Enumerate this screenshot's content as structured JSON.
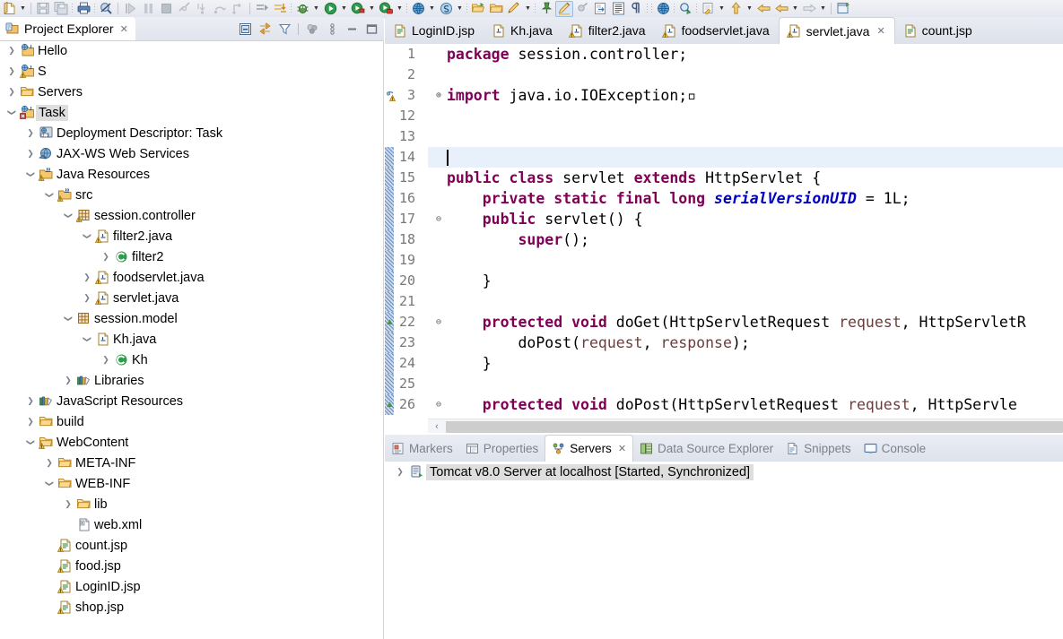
{
  "window": {
    "app": "Eclipse IDE"
  },
  "toolbar": {
    "items": [
      {
        "name": "new-wizard-icon",
        "kind": "icon",
        "icon": "new-file"
      },
      {
        "name": "new-wizard-dropdown",
        "kind": "arrow"
      },
      {
        "name": "toolbar-separator-1",
        "kind": "sep"
      },
      {
        "name": "save-icon",
        "kind": "icon",
        "icon": "save"
      },
      {
        "name": "save-all-icon",
        "kind": "icon",
        "icon": "save-all"
      },
      {
        "name": "toolbar-separator-2",
        "kind": "dots"
      },
      {
        "name": "print-icon",
        "kind": "icon",
        "icon": "print"
      },
      {
        "name": "toolbar-separator-3",
        "kind": "dots"
      },
      {
        "name": "no-search-icon",
        "kind": "icon",
        "icon": "search-disabled"
      },
      {
        "name": "toolbar-separator-4",
        "kind": "sep"
      },
      {
        "name": "resume-icon",
        "kind": "icon",
        "icon": "resume"
      },
      {
        "name": "suspend-icon",
        "kind": "icon",
        "icon": "suspend"
      },
      {
        "name": "terminate-icon",
        "kind": "icon",
        "icon": "terminate"
      },
      {
        "name": "disconnect-icon",
        "kind": "icon",
        "icon": "disconnect"
      },
      {
        "name": "step-into-icon",
        "kind": "icon",
        "icon": "step-into"
      },
      {
        "name": "step-over-icon",
        "kind": "icon",
        "icon": "step-over"
      },
      {
        "name": "step-return-icon",
        "kind": "icon",
        "icon": "step-return"
      },
      {
        "name": "toolbar-separator-5",
        "kind": "sep"
      },
      {
        "name": "next-annotation-icon",
        "kind": "icon",
        "icon": "next-annot"
      },
      {
        "name": "previous-annotation-icon",
        "kind": "icon",
        "icon": "prev-annot"
      },
      {
        "name": "toolbar-separator-6",
        "kind": "dots"
      },
      {
        "name": "debug-icon",
        "kind": "icon",
        "icon": "debug-bug"
      },
      {
        "name": "debug-dropdown",
        "kind": "arrow"
      },
      {
        "name": "run-icon",
        "kind": "icon",
        "icon": "run-green"
      },
      {
        "name": "run-dropdown",
        "kind": "arrow"
      },
      {
        "name": "run-server-icon",
        "kind": "icon",
        "icon": "run-server"
      },
      {
        "name": "run-server-dropdown",
        "kind": "arrow"
      },
      {
        "name": "run-toolkit-icon",
        "kind": "icon",
        "icon": "run-toolkit"
      },
      {
        "name": "run-toolkit-dropdown",
        "kind": "arrow"
      },
      {
        "name": "toolbar-separator-7",
        "kind": "dots"
      },
      {
        "name": "open-browser-icon",
        "kind": "icon",
        "icon": "globe"
      },
      {
        "name": "open-browser-dropdown",
        "kind": "arrow"
      },
      {
        "name": "new-wtp-icon",
        "kind": "icon",
        "icon": "blue-circle"
      },
      {
        "name": "new-wtp-dropdown",
        "kind": "arrow"
      },
      {
        "name": "toolbar-separator-8",
        "kind": "dots"
      },
      {
        "name": "open-type-icon",
        "kind": "icon",
        "icon": "folder-open-green"
      },
      {
        "name": "open-task-icon",
        "kind": "icon",
        "icon": "folder-plain"
      },
      {
        "name": "pencil-icon",
        "kind": "icon",
        "icon": "pencil"
      },
      {
        "name": "pencil-dropdown",
        "kind": "arrow"
      },
      {
        "name": "toolbar-separator-9",
        "kind": "dots"
      },
      {
        "name": "pin-icon",
        "kind": "icon",
        "icon": "pin"
      },
      {
        "name": "highlight-icon",
        "kind": "icon",
        "icon": "highlight",
        "active": true
      },
      {
        "name": "toggle-mark-icon",
        "kind": "icon",
        "icon": "mark-grey"
      },
      {
        "name": "import-icon",
        "kind": "icon",
        "icon": "import"
      },
      {
        "name": "outline-icon",
        "kind": "icon",
        "icon": "outline-list"
      },
      {
        "name": "pilcrow-icon",
        "kind": "icon",
        "icon": "pilcrow"
      },
      {
        "name": "toolbar-separator-10",
        "kind": "dots"
      },
      {
        "name": "toolbar-separator-11",
        "kind": "dots"
      },
      {
        "name": "web-browser-icon",
        "kind": "icon",
        "icon": "globe"
      },
      {
        "name": "toolbar-separator-12",
        "kind": "dots"
      },
      {
        "name": "search-run-icon",
        "kind": "icon",
        "icon": "search-run"
      },
      {
        "name": "toolbar-separator-13",
        "kind": "dots"
      },
      {
        "name": "last-edit-icon",
        "kind": "icon",
        "icon": "last-edit"
      },
      {
        "name": "last-edit-dropdown",
        "kind": "arrow"
      },
      {
        "name": "up-arrow-icon",
        "kind": "icon",
        "icon": "arrow-up-yellow"
      },
      {
        "name": "up-arrow-dropdown",
        "kind": "arrow"
      },
      {
        "name": "back-icon",
        "kind": "icon",
        "icon": "arrow-back"
      },
      {
        "name": "forward-back-icon",
        "kind": "icon",
        "icon": "arrow-back2"
      },
      {
        "name": "back-dropdown",
        "kind": "arrow"
      },
      {
        "name": "forward-icon",
        "kind": "icon",
        "icon": "arrow-forward-grey"
      },
      {
        "name": "forward-dropdown",
        "kind": "arrow"
      },
      {
        "name": "toolbar-separator-14",
        "kind": "sep"
      },
      {
        "name": "open-perspective-icon",
        "kind": "icon",
        "icon": "new-perspective"
      }
    ]
  },
  "project_explorer": {
    "title": "Project Explorer",
    "close_label": "✕",
    "tools": [
      {
        "name": "collapse-all-icon",
        "icon": "collapse-all"
      },
      {
        "name": "link-with-editor-icon",
        "icon": "link-editor"
      },
      {
        "name": "view-filter-icon",
        "icon": "filter"
      },
      {
        "name": "separator",
        "icon": "sep"
      },
      {
        "name": "working-sets-icon",
        "icon": "working-sets"
      },
      {
        "name": "view-menu-icon",
        "icon": "view-menu"
      },
      {
        "name": "minimize-view-icon",
        "icon": "minimize"
      },
      {
        "name": "maximize-view-icon",
        "icon": "maximize"
      }
    ],
    "tree": [
      {
        "label": "Hello",
        "depth": 0,
        "twisty": "collapsed",
        "icon": "java-project",
        "selected": false
      },
      {
        "label": "S",
        "depth": 0,
        "twisty": "collapsed",
        "icon": "java-project-warn",
        "selected": false
      },
      {
        "label": "Servers",
        "depth": 0,
        "twisty": "collapsed",
        "icon": "folder",
        "selected": false
      },
      {
        "label": "Task",
        "depth": 0,
        "twisty": "expanded",
        "icon": "java-project-error",
        "selected": true
      },
      {
        "label": "Deployment Descriptor: Task",
        "depth": 1,
        "twisty": "collapsed",
        "icon": "deployment-descriptor",
        "selected": false
      },
      {
        "label": "JAX-WS Web Services",
        "depth": 1,
        "twisty": "collapsed",
        "icon": "web-services",
        "selected": false
      },
      {
        "label": "Java Resources",
        "depth": 1,
        "twisty": "expanded",
        "icon": "java-resources",
        "selected": false
      },
      {
        "label": "src",
        "depth": 2,
        "twisty": "expanded",
        "icon": "source-folder",
        "selected": false
      },
      {
        "label": "session.controller",
        "depth": 3,
        "twisty": "expanded",
        "icon": "package-warn",
        "selected": false
      },
      {
        "label": "filter2.java",
        "depth": 4,
        "twisty": "expanded",
        "icon": "java-file-warn",
        "selected": false
      },
      {
        "label": "filter2",
        "depth": 5,
        "twisty": "collapsed",
        "icon": "class",
        "selected": false
      },
      {
        "label": "foodservlet.java",
        "depth": 4,
        "twisty": "collapsed",
        "icon": "java-file-warn",
        "selected": false
      },
      {
        "label": "servlet.java",
        "depth": 4,
        "twisty": "collapsed",
        "icon": "java-file-warn",
        "selected": false
      },
      {
        "label": "session.model",
        "depth": 3,
        "twisty": "expanded",
        "icon": "package",
        "selected": false
      },
      {
        "label": "Kh.java",
        "depth": 4,
        "twisty": "expanded",
        "icon": "java-file",
        "selected": false
      },
      {
        "label": "Kh",
        "depth": 5,
        "twisty": "collapsed",
        "icon": "class",
        "selected": false
      },
      {
        "label": "Libraries",
        "depth": 3,
        "twisty": "collapsed",
        "icon": "library",
        "selected": false
      },
      {
        "label": "JavaScript Resources",
        "depth": 1,
        "twisty": "collapsed",
        "icon": "library",
        "selected": false
      },
      {
        "label": "build",
        "depth": 1,
        "twisty": "collapsed",
        "icon": "folder",
        "selected": false
      },
      {
        "label": "WebContent",
        "depth": 1,
        "twisty": "expanded",
        "icon": "folder-warn",
        "selected": false
      },
      {
        "label": "META-INF",
        "depth": 2,
        "twisty": "collapsed",
        "icon": "folder",
        "selected": false
      },
      {
        "label": "WEB-INF",
        "depth": 2,
        "twisty": "expanded",
        "icon": "folder",
        "selected": false
      },
      {
        "label": "lib",
        "depth": 3,
        "twisty": "collapsed",
        "icon": "folder",
        "selected": false
      },
      {
        "label": "web.xml",
        "depth": 3,
        "twisty": "none",
        "icon": "xml-file",
        "selected": false
      },
      {
        "label": "count.jsp",
        "depth": 2,
        "twisty": "none",
        "icon": "jsp-file-warn",
        "selected": false
      },
      {
        "label": "food.jsp",
        "depth": 2,
        "twisty": "none",
        "icon": "jsp-file-warn",
        "selected": false
      },
      {
        "label": "LoginID.jsp",
        "depth": 2,
        "twisty": "none",
        "icon": "jsp-file-warn",
        "selected": false
      },
      {
        "label": "shop.jsp",
        "depth": 2,
        "twisty": "none",
        "icon": "jsp-file-warn",
        "selected": false
      }
    ]
  },
  "editor": {
    "tabs": [
      {
        "label": "LoginID.jsp",
        "icon": "jsp-file",
        "active": false,
        "closable": false
      },
      {
        "label": "Kh.java",
        "icon": "java-file",
        "active": false,
        "closable": false
      },
      {
        "label": "filter2.java",
        "icon": "java-file-warn",
        "active": false,
        "closable": false
      },
      {
        "label": "foodservlet.java",
        "icon": "java-file-warn",
        "active": false,
        "closable": false
      },
      {
        "label": "servlet.java",
        "icon": "java-file-warn",
        "active": true,
        "closable": true,
        "close_label": "✕"
      },
      {
        "label": "count.jsp",
        "icon": "jsp-file",
        "active": false,
        "closable": false
      }
    ],
    "current_line": 14,
    "scroll": {
      "left_arrow": "‹"
    },
    "lines": [
      {
        "num": "1",
        "fold": "",
        "marker": "none",
        "segments": [
          {
            "t": "package",
            "c": "k"
          },
          {
            "t": " session.controller;",
            "c": "plain"
          }
        ]
      },
      {
        "num": "2",
        "fold": "",
        "marker": "none",
        "segments": []
      },
      {
        "num": "3",
        "fold": "⊕",
        "marker": "warning",
        "segments": [
          {
            "t": "import",
            "c": "k"
          },
          {
            "t": " java.io.IOException;",
            "c": "plain"
          },
          {
            "t": "▫",
            "c": "plain"
          }
        ]
      },
      {
        "num": "12",
        "fold": "",
        "marker": "none",
        "segments": []
      },
      {
        "num": "13",
        "fold": "",
        "marker": "none",
        "segments": []
      },
      {
        "num": "14",
        "fold": "",
        "marker": "changed",
        "segments": []
      },
      {
        "num": "15",
        "fold": "",
        "marker": "changed",
        "segments": [
          {
            "t": "public class",
            "c": "k"
          },
          {
            "t": " servlet ",
            "c": "plain"
          },
          {
            "t": "extends",
            "c": "k"
          },
          {
            "t": " HttpServlet {",
            "c": "plain"
          }
        ]
      },
      {
        "num": "16",
        "fold": "",
        "marker": "changed",
        "segments": [
          {
            "t": "    ",
            "c": "plain"
          },
          {
            "t": "private static final long",
            "c": "k"
          },
          {
            "t": " ",
            "c": "plain"
          },
          {
            "t": "serialVersionUID",
            "c": "fieldi"
          },
          {
            "t": " = 1L;",
            "c": "plain"
          }
        ]
      },
      {
        "num": "17",
        "fold": "⊖",
        "marker": "changed",
        "segments": [
          {
            "t": "    ",
            "c": "plain"
          },
          {
            "t": "public",
            "c": "k"
          },
          {
            "t": " servlet() {",
            "c": "plain"
          }
        ]
      },
      {
        "num": "18",
        "fold": "",
        "marker": "changed",
        "segments": [
          {
            "t": "        ",
            "c": "plain"
          },
          {
            "t": "super",
            "c": "k"
          },
          {
            "t": "();",
            "c": "plain"
          }
        ]
      },
      {
        "num": "19",
        "fold": "",
        "marker": "changed",
        "segments": []
      },
      {
        "num": "20",
        "fold": "",
        "marker": "changed",
        "segments": [
          {
            "t": "    }",
            "c": "plain"
          }
        ]
      },
      {
        "num": "21",
        "fold": "",
        "marker": "changed",
        "segments": []
      },
      {
        "num": "22",
        "fold": "⊖",
        "marker": "changed-overview",
        "segments": [
          {
            "t": "    ",
            "c": "plain"
          },
          {
            "t": "protected void",
            "c": "k"
          },
          {
            "t": " doGet(HttpServletRequest ",
            "c": "plain"
          },
          {
            "t": "request",
            "c": "param"
          },
          {
            "t": ", HttpServletR",
            "c": "plain"
          }
        ]
      },
      {
        "num": "23",
        "fold": "",
        "marker": "changed",
        "segments": [
          {
            "t": "        doPost(",
            "c": "plain"
          },
          {
            "t": "request",
            "c": "param"
          },
          {
            "t": ", ",
            "c": "plain"
          },
          {
            "t": "response",
            "c": "param"
          },
          {
            "t": ");",
            "c": "plain"
          }
        ]
      },
      {
        "num": "24",
        "fold": "",
        "marker": "changed",
        "segments": [
          {
            "t": "    }",
            "c": "plain"
          }
        ]
      },
      {
        "num": "25",
        "fold": "",
        "marker": "changed",
        "segments": []
      },
      {
        "num": "26",
        "fold": "⊖",
        "marker": "changed-overview",
        "segments": [
          {
            "t": "    ",
            "c": "plain"
          },
          {
            "t": "protected void",
            "c": "k"
          },
          {
            "t": " doPost(HttpServletRequest ",
            "c": "plain"
          },
          {
            "t": "request",
            "c": "param"
          },
          {
            "t": ", HttpServle",
            "c": "plain"
          }
        ]
      }
    ]
  },
  "bottom_panel": {
    "tabs": [
      {
        "label": "Markers",
        "icon": "markers",
        "active": false,
        "closable": false
      },
      {
        "label": "Properties",
        "icon": "properties",
        "active": false,
        "closable": false
      },
      {
        "label": "Servers",
        "icon": "servers",
        "active": true,
        "closable": true,
        "close_label": "✕"
      },
      {
        "label": "Data Source Explorer",
        "icon": "data-source",
        "active": false,
        "closable": false
      },
      {
        "label": "Snippets",
        "icon": "snippets",
        "active": false,
        "closable": false
      },
      {
        "label": "Console",
        "icon": "console",
        "active": false,
        "closable": false
      }
    ],
    "servers": [
      {
        "name": "Tomcat v8.0 Server at localhost",
        "status": "[Started, Synchronized]",
        "twisty": "collapsed",
        "icon": "server-started"
      }
    ]
  },
  "colors": {
    "keyword": "#7f0055",
    "field_italic": "#0000c0",
    "parameter": "#6a3e3e",
    "selection_grey": "#dedede",
    "current_line": "#e8f0fb"
  }
}
